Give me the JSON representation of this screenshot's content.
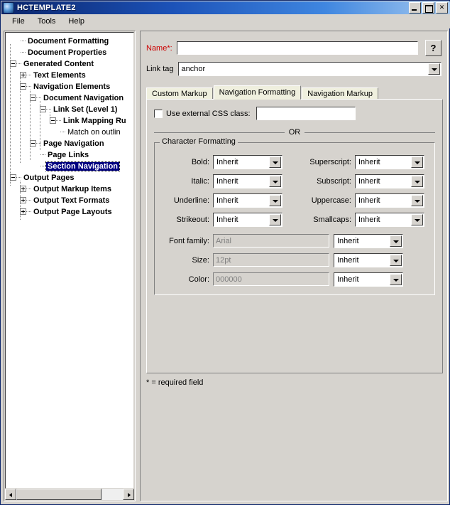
{
  "window": {
    "title": "HCTEMPLATE2",
    "icon": "app-icon",
    "controls": {
      "minimize": "Minimize",
      "maximize": "Maximize",
      "close": "Close"
    }
  },
  "menubar": {
    "items": [
      "File",
      "Tools",
      "Help"
    ]
  },
  "tree": {
    "nodes": [
      {
        "label": "Document Formatting",
        "depth": 1,
        "toggle": "none",
        "leaf": false,
        "selected": false
      },
      {
        "label": "Document Properties",
        "depth": 1,
        "toggle": "none",
        "leaf": false,
        "selected": false
      },
      {
        "label": "Generated Content",
        "depth": 0,
        "toggle": "expanded",
        "leaf": false,
        "selected": false
      },
      {
        "label": "Text Elements",
        "depth": 1,
        "toggle": "collapsed",
        "leaf": false,
        "selected": false
      },
      {
        "label": "Navigation Elements",
        "depth": 1,
        "toggle": "expanded",
        "leaf": false,
        "selected": false
      },
      {
        "label": "Document Navigation",
        "depth": 2,
        "toggle": "expanded",
        "leaf": false,
        "selected": false
      },
      {
        "label": "Link Set (Level 1)",
        "depth": 3,
        "toggle": "expanded",
        "leaf": false,
        "selected": false
      },
      {
        "label": "Link Mapping Ru",
        "depth": 4,
        "toggle": "expanded",
        "leaf": false,
        "selected": false
      },
      {
        "label": "Match on outlin",
        "depth": 5,
        "toggle": "none",
        "leaf": true,
        "selected": false
      },
      {
        "label": "Page Navigation",
        "depth": 2,
        "toggle": "expanded",
        "leaf": false,
        "selected": false
      },
      {
        "label": "Page Links",
        "depth": 3,
        "toggle": "none",
        "leaf": false,
        "selected": false
      },
      {
        "label": "Section Navigation",
        "depth": 3,
        "toggle": "none",
        "leaf": false,
        "selected": true
      },
      {
        "label": "Output Pages",
        "depth": 0,
        "toggle": "expanded",
        "leaf": false,
        "selected": false
      },
      {
        "label": "Output Markup Items",
        "depth": 1,
        "toggle": "collapsed",
        "leaf": false,
        "selected": false
      },
      {
        "label": "Output Text Formats",
        "depth": 1,
        "toggle": "collapsed",
        "leaf": false,
        "selected": false
      },
      {
        "label": "Output Page Layouts",
        "depth": 1,
        "toggle": "collapsed",
        "leaf": false,
        "selected": false
      }
    ],
    "scrollbar": {
      "left_arrow": "left-arrow",
      "right_arrow": "right-arrow",
      "thumb_percent": 80
    }
  },
  "form": {
    "name_label": "Name*:",
    "name_value": "",
    "name_placeholder": "",
    "help_label": "?",
    "linktag_label": "Link tag",
    "linktag_value": "anchor",
    "tabs": [
      {
        "label": "Custom Markup",
        "active": false
      },
      {
        "label": "Navigation Formatting",
        "active": true
      },
      {
        "label": "Navigation Markup",
        "active": false
      }
    ],
    "css_checkbox_label": "Use external CSS class:",
    "css_checkbox_checked": false,
    "css_class_value": "",
    "or_text": "OR",
    "group_title": "Character Formatting",
    "char_rows": [
      {
        "left_label": "Bold:",
        "left_value": "Inherit",
        "right_label": "Superscript:",
        "right_value": "Inherit"
      },
      {
        "left_label": "Italic:",
        "left_value": "Inherit",
        "right_label": "Subscript:",
        "right_value": "Inherit"
      },
      {
        "left_label": "Underline:",
        "left_value": "Inherit",
        "right_label": "Uppercase:",
        "right_value": "Inherit"
      },
      {
        "left_label": "Strikeout:",
        "left_value": "Inherit",
        "right_label": "Smallcaps:",
        "right_value": "Inherit"
      }
    ],
    "font_rows": [
      {
        "label": "Font family:",
        "value": "Arial",
        "mode": "Inherit"
      },
      {
        "label": "Size:",
        "value": "12pt",
        "mode": "Inherit"
      },
      {
        "label": "Color:",
        "value": "000000",
        "mode": "Inherit"
      }
    ],
    "footnote": "* = required field"
  },
  "colors": {
    "window_face": "#d6d3ce",
    "title_start": "#0a246a",
    "title_end": "#a6caf0",
    "required": "#cc0000",
    "selection": "#000080",
    "tab_face": "#efefde"
  }
}
